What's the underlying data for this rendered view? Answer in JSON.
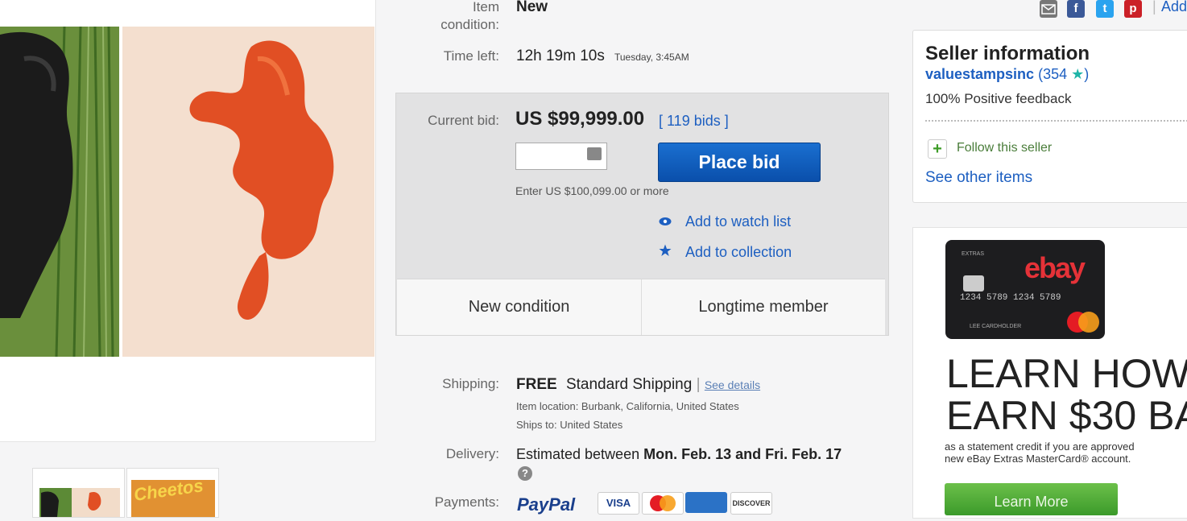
{
  "item": {
    "condition_label": "Item condition:",
    "condition_value": "New",
    "time_left_label": "Time left:",
    "time_left_value": "12h 19m 10s",
    "time_left_end": "Tuesday, 3:45AM"
  },
  "bid": {
    "current_label": "Current bid:",
    "current_value": "US $99,999.00",
    "bids_count": "[ 119 bids ]",
    "place_bid_label": "Place bid",
    "enter_hint": "Enter US $100,099.00 or more",
    "watch_label": "Add to watch list",
    "collection_label": "Add to collection",
    "badges": [
      "New condition",
      "Longtime member"
    ]
  },
  "shipping": {
    "label": "Shipping:",
    "free": "FREE",
    "method": "Standard Shipping",
    "separator": "|",
    "see_details": "See details",
    "location": "Item location:  Burbank, California, United States",
    "ships_to": "Ships to:  United States"
  },
  "delivery": {
    "label": "Delivery:",
    "text": "Estimated between",
    "dates": "Mon. Feb. 13 and Fri. Feb. 17",
    "help_icon": "?"
  },
  "payments": {
    "label": "Payments:",
    "paypal": "PayPal",
    "visa": "VISA",
    "discover": "DISCOVER"
  },
  "share": {
    "add_label": "Add",
    "icons": [
      "email-icon",
      "facebook-icon",
      "twitter-icon",
      "pinterest-icon"
    ]
  },
  "seller": {
    "heading": "Seller information",
    "name": "valuestampsinc",
    "score": "(354",
    "score_close": ")",
    "feedback": "100% Positive feedback",
    "follow": "Follow this seller",
    "see_other": "See other items"
  },
  "ad": {
    "card_brand": "ebay",
    "card_tier": "EXTRAS",
    "card_number": "1234 5789 1234 5789",
    "card_holder": "LEE CARDHOLDER",
    "headline_1": "LEARN HOW",
    "headline_2": "EARN $30 BA",
    "body": "as a statement credit if you are approved",
    "body_2": "new eBay Extras MasterCard® account.",
    "cta": "Learn More"
  },
  "thumbs": {
    "cheeto_logo": "Cheetos"
  },
  "colors": {
    "link": "#1d5fc1",
    "place_bid": "#0f5ec0",
    "bid_box": "#e2e2e3",
    "follow_green": "#3d9c27",
    "cta_green": "#4aae35"
  }
}
